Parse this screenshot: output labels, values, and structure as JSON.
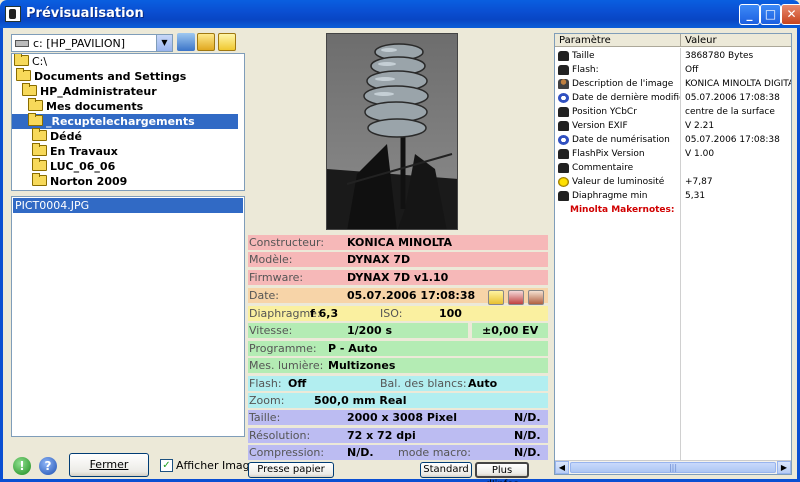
{
  "window": {
    "title": "Prévisualisation"
  },
  "drive": {
    "selected": "c: [HP_PAVILION]"
  },
  "tree": [
    {
      "label": "C:\\",
      "indent": 0,
      "bold": false,
      "selected": false
    },
    {
      "label": "Documents and Settings",
      "indent": 1,
      "bold": true,
      "selected": false
    },
    {
      "label": "HP_Administrateur",
      "indent": 2,
      "bold": true,
      "selected": false
    },
    {
      "label": "Mes documents",
      "indent": 3,
      "bold": true,
      "selected": false
    },
    {
      "label": "_Recuptelechargements",
      "indent": 4,
      "bold": true,
      "selected": true
    },
    {
      "label": "Dédé",
      "indent": 5,
      "bold": true,
      "selected": false
    },
    {
      "label": "En Travaux",
      "indent": 5,
      "bold": true,
      "selected": false
    },
    {
      "label": "LUC_06_06",
      "indent": 5,
      "bold": true,
      "selected": false
    },
    {
      "label": "Norton 2009",
      "indent": 5,
      "bold": true,
      "selected": false
    }
  ],
  "files": {
    "selected": "PICT0004.JPG"
  },
  "bottom_left": {
    "close_label": "Fermer",
    "show_image_label": "Afficher Image",
    "show_image_checked": "✓"
  },
  "info": {
    "constructeur": {
      "label": "Constructeur:",
      "value": "KONICA MINOLTA"
    },
    "modele": {
      "label": "Modèle:",
      "value": "DYNAX 7D"
    },
    "firmware": {
      "label": "Firmware:",
      "value": "DYNAX 7D v1.10"
    },
    "date": {
      "label": "Date:",
      "value": "05.07.2006 17:08:38"
    },
    "diaphragme": {
      "label": "Diaphragme:",
      "value": "f 6,3"
    },
    "iso": {
      "label": "ISO:",
      "value": "100"
    },
    "vitesse": {
      "label": "Vitesse:",
      "value": "1/200 s"
    },
    "ev": {
      "value": "±0,00 EV"
    },
    "programme": {
      "label": "Programme:",
      "value": "P - Auto"
    },
    "mes_lumiere": {
      "label": "Mes. lumière:",
      "value": "Multizones"
    },
    "flash": {
      "label": "Flash:",
      "value": "Off"
    },
    "bal_blancs": {
      "label": "Bal. des blancs:",
      "value": "Auto"
    },
    "zoom": {
      "label": "Zoom:",
      "value": "500,0 mm Real"
    },
    "taille": {
      "label": "Taille:",
      "value": "2000 x 3008 Pixel",
      "extra": "N/D."
    },
    "resolution": {
      "label": "Résolution:",
      "value": "72 x 72 dpi",
      "extra": "N/D."
    },
    "compression": {
      "label": "Compression:",
      "value": "N/D."
    },
    "mode_macro": {
      "label": "mode macro:",
      "value": "N/D."
    }
  },
  "buttons": {
    "clipboard": "Presse papier",
    "standard": "Standard",
    "more_info": "Plus d'infos"
  },
  "exif": {
    "col_param": "Paramètre",
    "col_value": "Valeur",
    "rows": [
      {
        "param": "Taille",
        "value": "3868780 Bytes",
        "icon": "camera-icon"
      },
      {
        "param": "Flash:",
        "value": "Off",
        "icon": "camera-icon"
      },
      {
        "param": "Description de l'image",
        "value": "KONICA MINOLTA DIGITA",
        "icon": "person-icon"
      },
      {
        "param": "Date de dernière modific...",
        "value": "05.07.2006 17:08:38",
        "icon": "clock-icon"
      },
      {
        "param": "Position YCbCr",
        "value": "centre de la surface",
        "icon": "camera-icon"
      },
      {
        "param": "Version EXIF",
        "value": "V 2.21",
        "icon": "camera-icon"
      },
      {
        "param": "Date de numérisation",
        "value": "05.07.2006 17:08:38",
        "icon": "clock-icon"
      },
      {
        "param": "FlashPix Version",
        "value": "V 1.00",
        "icon": "camera-icon"
      },
      {
        "param": "Commentaire",
        "value": "",
        "icon": "camera-icon"
      },
      {
        "param": "Valeur de luminosité",
        "value": "+7,87",
        "icon": "sun-icon"
      },
      {
        "param": "Diaphragme min",
        "value": "5,31",
        "icon": "camera-icon"
      },
      {
        "param": "Minolta Makernotes:",
        "value": "",
        "icon": ""
      }
    ]
  }
}
